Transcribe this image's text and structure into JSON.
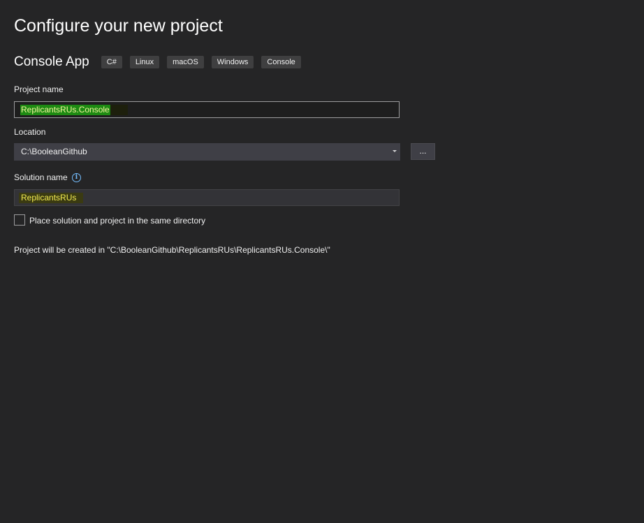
{
  "page": {
    "title": "Configure your new project"
  },
  "template": {
    "name": "Console App",
    "tags": [
      "C#",
      "Linux",
      "macOS",
      "Windows",
      "Console"
    ]
  },
  "project_name": {
    "label": "Project name",
    "value": "ReplicantsRUs.Console"
  },
  "location": {
    "label": "Location",
    "value": "C:\\BooleanGithub",
    "browse_label": "..."
  },
  "solution_name": {
    "label": "Solution name",
    "info_icon": "info-icon",
    "value": "ReplicantsRUs"
  },
  "same_directory": {
    "label": "Place solution and project in the same directory",
    "checked": false
  },
  "path_info": "Project will be created in \"C:\\BooleanGithub\\ReplicantsRUs\\ReplicantsRUs.Console\\\"",
  "colors": {
    "background": "#252526",
    "highlight_green": "#1d8a12",
    "highlight_yellow_text": "#f4ec52",
    "info_blue": "#75beff"
  }
}
